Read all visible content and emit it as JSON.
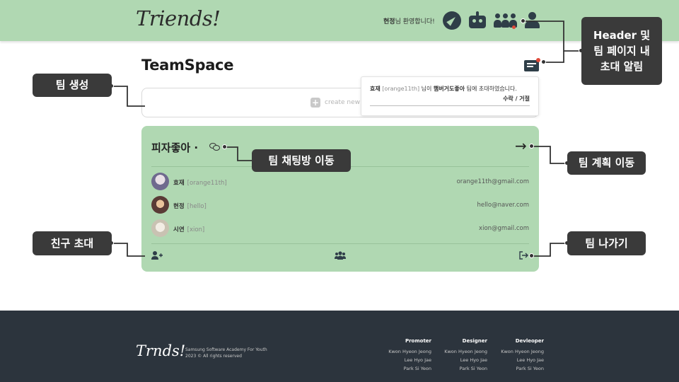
{
  "header": {
    "logo": "Triends!",
    "welcome_name": "현정",
    "welcome_suffix": "님 환영합니다!",
    "icons": [
      "compass-icon",
      "robot-icon",
      "people-icon",
      "user-icon"
    ]
  },
  "page": {
    "title": "TeamSpace",
    "create_placeholder": "create new t",
    "icons": [
      "mail-icon",
      "plus-icon"
    ]
  },
  "notification": {
    "sender_name": "효재",
    "sender_id": "[orange11th]",
    "text_mid": "님이",
    "team": "햄버거도좋아",
    "text_end": "팀에 초대하였습니다.",
    "actions": "수락 / 거절"
  },
  "team": {
    "name": "피자좋아 ·",
    "members": [
      {
        "name": "효재",
        "id": "[orange11th]",
        "email": "orange11th@gmail.com",
        "avatar_color": "#6f6a8e"
      },
      {
        "name": "현정",
        "id": "[hello]",
        "email": "hello@naver.com",
        "avatar_color": "#5a3b36"
      },
      {
        "name": "시연",
        "id": "[xion]",
        "email": "xion@gmail.com",
        "avatar_color": "#c9c2b2"
      }
    ],
    "icons": [
      "chat-icon",
      "arrow-right-icon",
      "add-user-icon",
      "group-icon",
      "exit-icon"
    ]
  },
  "annotations": {
    "create_team": "팀 생성",
    "header_notify": "Header 및\n팀 페이지 내\n초대 알림",
    "chat_move": "팀 채팅방 이동",
    "plan_move": "팀 계획 이동",
    "invite_friend": "친구 초대",
    "leave_team": "팀 나가기"
  },
  "footer": {
    "logo": "Trnds!",
    "copy1": "Samsung Software Academy For Youth",
    "copy2": "2023 © All rights reserved",
    "columns": [
      {
        "title": "Promoter",
        "names": [
          "Kwon Hyeon Jeong",
          "Lee Hyo Jae",
          "Park Si Yeon"
        ]
      },
      {
        "title": "Designer",
        "names": [
          "Kwon Hyeon Jeong",
          "Lee Hyo Jae",
          "Park Si Yeon"
        ]
      },
      {
        "title": "Devleoper",
        "names": [
          "Kwon Hyeon Jeong",
          "Lee Hyo Jae",
          "Park Si Yeon"
        ]
      }
    ]
  },
  "colors": {
    "header_bg": "#b0d8b2",
    "card_bg": "#b0d8b2",
    "footer_bg": "#2c343d",
    "annotation_bg": "#3a3a3a",
    "badge": "#e04a3a"
  }
}
